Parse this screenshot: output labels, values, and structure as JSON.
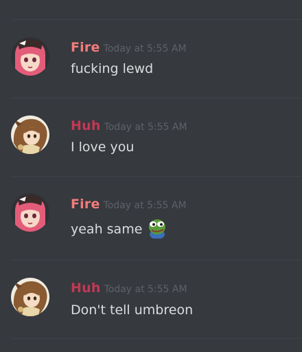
{
  "colors": {
    "background": "#36393e",
    "fire_author": "#f47c7c",
    "huh_author": "#c23955",
    "timestamp": "#5e6269",
    "message_text": "#dcddde"
  },
  "messages": [
    {
      "author": "Fire",
      "author_color": "#f47c7c",
      "avatar": "pink-hair-anime-girl-avatar",
      "timestamp": "Today at 5:55 AM",
      "content": "fucking lewd",
      "emoji": null
    },
    {
      "author": "Huh",
      "author_color": "#c23955",
      "avatar": "brown-hair-anime-character-avatar",
      "timestamp": "Today at 5:55 AM",
      "content": "I love you",
      "emoji": null
    },
    {
      "author": "Fire",
      "author_color": "#f47c7c",
      "avatar": "pink-hair-anime-girl-avatar",
      "timestamp": "Today at 5:55 AM",
      "content": "yeah same",
      "emoji": "pepe-frog-emoji"
    },
    {
      "author": "Huh",
      "author_color": "#c23955",
      "avatar": "brown-hair-anime-character-avatar",
      "timestamp": "Today at 5:55 AM",
      "content": "Don't tell umbreon",
      "emoji": null
    }
  ]
}
